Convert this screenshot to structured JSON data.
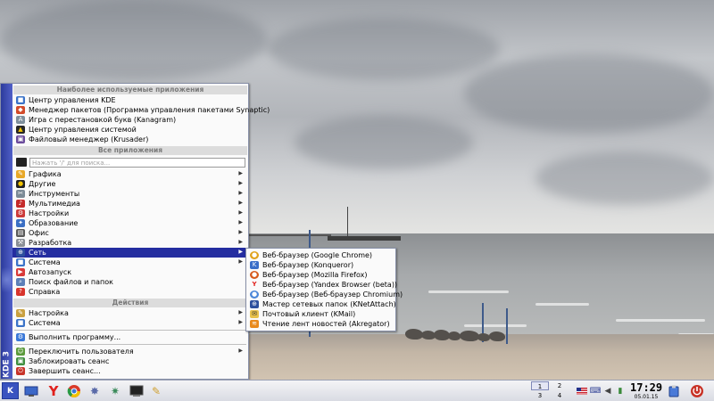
{
  "menu": {
    "side_label": "KDE 3",
    "favorites_header": "Наиболее используемые приложения",
    "favorites": [
      {
        "label": "Центр управления KDE",
        "icon": "kde-control-center-icon"
      },
      {
        "label": "Менеджер пакетов (Программа управления пакетами Synaptic)",
        "icon": "package-manager-icon"
      },
      {
        "label": "Игра с перестановкой букв (Kanagram)",
        "icon": "kanagram-icon"
      },
      {
        "label": "Центр управления системой",
        "icon": "system-control-center-icon"
      },
      {
        "label": "Файловый менеджер (Krusader)",
        "icon": "krusader-icon"
      }
    ],
    "all_apps_header": "Все приложения",
    "search_placeholder": "Нажать '/' для поиска...",
    "categories": [
      {
        "label": "Графика",
        "icon": "graphics-icon",
        "submenu": true
      },
      {
        "label": "Другие",
        "icon": "other-icon",
        "submenu": true
      },
      {
        "label": "Инструменты",
        "icon": "tools-icon",
        "submenu": true
      },
      {
        "label": "Мультимедиа",
        "icon": "multimedia-icon",
        "submenu": true
      },
      {
        "label": "Настройки",
        "icon": "settings-icon",
        "submenu": true
      },
      {
        "label": "Образование",
        "icon": "education-icon",
        "submenu": true
      },
      {
        "label": "Офис",
        "icon": "office-icon",
        "submenu": true
      },
      {
        "label": "Разработка",
        "icon": "development-icon",
        "submenu": true
      },
      {
        "label": "Сеть",
        "icon": "network-icon",
        "submenu": true,
        "highlighted": true
      },
      {
        "label": "Система",
        "icon": "system-icon",
        "submenu": true
      },
      {
        "label": "Автозапуск",
        "icon": "autostart-icon",
        "submenu": false
      },
      {
        "label": "Поиск файлов и папок",
        "icon": "find-files-icon",
        "submenu": false
      },
      {
        "label": "Справка",
        "icon": "help-icon",
        "submenu": false
      }
    ],
    "actions_header": "Действия",
    "actions": [
      {
        "label": "Настройка",
        "icon": "configure-icon",
        "submenu": true
      },
      {
        "label": "Система",
        "icon": "system-actions-icon",
        "submenu": true
      }
    ],
    "run_command": "Выполнить программу...",
    "session": [
      {
        "label": "Переключить пользователя",
        "icon": "switch-user-icon",
        "submenu": true
      },
      {
        "label": "Заблокировать сеанс",
        "icon": "lock-session-icon",
        "submenu": false
      },
      {
        "label": "Завершить сеанс...",
        "icon": "logout-icon",
        "submenu": false
      }
    ]
  },
  "network_submenu": [
    {
      "label": "Веб-браузер (Google Chrome)",
      "icon": "chrome-icon"
    },
    {
      "label": "Веб-браузер (Konqueror)",
      "icon": "konqueror-icon"
    },
    {
      "label": "Веб-браузер (Mozilla Firefox)",
      "icon": "firefox-icon"
    },
    {
      "label": "Веб-браузер (Yandex Browser (beta))",
      "icon": "yandex-icon"
    },
    {
      "label": "Веб-браузер (Веб-браузер Chromium)",
      "icon": "chromium-icon"
    },
    {
      "label": "Мастер сетевых папок (KNetAttach)",
      "icon": "knetattach-icon"
    },
    {
      "label": "Почтовый клиент (KMail)",
      "icon": "kmail-icon"
    },
    {
      "label": "Чтение лент новостей (Akregator)",
      "icon": "akregator-icon"
    }
  ],
  "panel": {
    "start_button": "K",
    "quick_launch": [
      "home-icon",
      "yandex-browser-icon",
      "chrome-icon",
      "satellite-icon",
      "network-tool-icon",
      "terminal-icon",
      "wrench-icon"
    ],
    "pager": [
      "1",
      "2",
      "3",
      "4"
    ],
    "active_desktop": "1",
    "tray": [
      "flag-us-icon",
      "keyboard-icon",
      "volume-icon",
      "signal-icon",
      "arrow-icon"
    ],
    "clock_time": "17:29",
    "clock_date": "05.01.15",
    "right_icons": [
      "clipboard-icon",
      "power-icon"
    ]
  },
  "colors": {
    "menu_side": "#2c3b9c",
    "highlight": "#242da0",
    "panel": "#dde0e8"
  }
}
